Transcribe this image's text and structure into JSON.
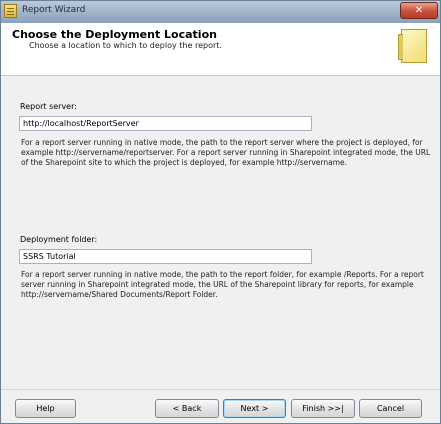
{
  "window": {
    "title": "Report Wizard",
    "close_glyph": "✕"
  },
  "header": {
    "title": "Choose the Deployment Location",
    "subtitle": "Choose a location to which to deploy the report."
  },
  "report_server": {
    "label": "Report server:",
    "value": "http://localhost/ReportServer",
    "help": "For a report server running in native mode, the path to the report server where the project is deployed, for example http://servername/reportserver.  For a report server running in Sharepoint integrated mode, the URL of the Sharepoint site to which the project is deployed, for example http://servername."
  },
  "deployment_folder": {
    "label": "Deployment folder:",
    "value": "SSRS Tutorial",
    "help": "For a report server running in native mode, the path to the report folder, for example /Reports.  For a report server running in Sharepoint integrated mode, the URL of the Sharepoint library for reports, for example http://servername/Shared Documents/Report Folder."
  },
  "buttons": {
    "help": "Help",
    "back": "< Back",
    "next": "Next >",
    "finish": "Finish >>|",
    "cancel": "Cancel"
  }
}
